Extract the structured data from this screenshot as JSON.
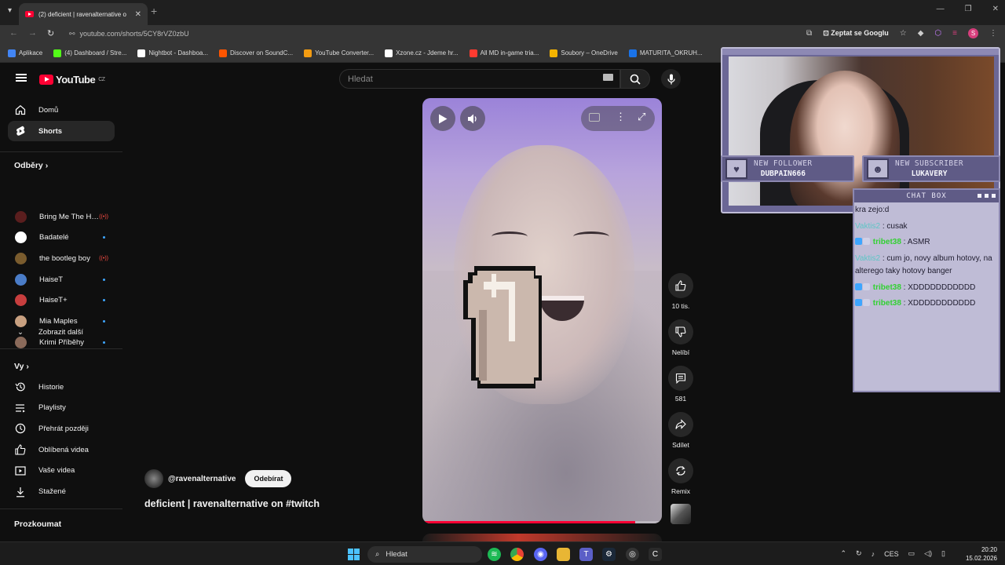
{
  "browser": {
    "tab_title": "(2) deficient | ravenalternative o",
    "url": "youtube.com/shorts/5CY8rVZ0zbU",
    "ask_google": "Zeptat se Googlu",
    "profile_initial": "S",
    "bookmarks": [
      {
        "label": "Aplikace",
        "color": "#4285f4"
      },
      {
        "label": "(4) Dashboard / Stre...",
        "color": "#53fc18"
      },
      {
        "label": "Nightbot - Dashboa...",
        "color": "#ffffff"
      },
      {
        "label": "Discover on SoundC...",
        "color": "#ff5500"
      },
      {
        "label": "YouTube Converter...",
        "color": "#f39c12"
      },
      {
        "label": "Xzone.cz - Jdeme hr...",
        "color": "#ffffff"
      },
      {
        "label": "All MD in-game tria...",
        "color": "#ff3b30"
      },
      {
        "label": "Soubory – OneDrive",
        "color": "#f4b400"
      },
      {
        "label": "MATURITA_OKRUH...",
        "color": "#1a73e8"
      }
    ]
  },
  "youtube": {
    "logo_text": "YouTube",
    "region": "CZ",
    "search_placeholder": "Hledat",
    "sidebar": {
      "main": [
        {
          "label": "Domů",
          "icon": "home-icon"
        },
        {
          "label": "Shorts",
          "icon": "shorts-icon",
          "active": true
        }
      ],
      "subs_title": "Odběry",
      "subs": [
        {
          "label": "Bring Me The Ho...",
          "avatar": "#5a1e1e",
          "live": true
        },
        {
          "label": "Badatelé",
          "avatar": "#ffffff",
          "live": false
        },
        {
          "label": "the bootleg boy",
          "avatar": "#7a5c2e",
          "live": true
        },
        {
          "label": "HaiseT",
          "avatar": "#4a7cc7",
          "live": false
        },
        {
          "label": "HaiseT+",
          "avatar": "#c73e3e",
          "live": false
        },
        {
          "label": "Mia Maples",
          "avatar": "#c8a080",
          "live": false
        },
        {
          "label": "Krimi Příběhy",
          "avatar": "#8a6a5a",
          "live": false
        }
      ],
      "show_more": "Zobrazit další",
      "you_title": "Vy",
      "you": [
        {
          "label": "Historie",
          "icon": "history-icon"
        },
        {
          "label": "Playlisty",
          "icon": "playlist-icon"
        },
        {
          "label": "Přehrát později",
          "icon": "clock-icon"
        },
        {
          "label": "Oblíbená videa",
          "icon": "like-icon"
        },
        {
          "label": "Vaše videa",
          "icon": "video-icon"
        },
        {
          "label": "Stažené",
          "icon": "download-icon"
        }
      ],
      "explore_title": "Prozkoumat"
    },
    "short": {
      "channel": "@ravenalternative",
      "subscribe_label": "Odebírat",
      "title": "deficient | ravenalternative on #twitch",
      "likes": "10 tis.",
      "dislike_label": "Nelíbí",
      "comments": "581",
      "share_label": "Sdílet",
      "remix_label": "Remix",
      "progress": 0.89
    }
  },
  "stream_overlay": {
    "new_follower_label": "NEW FOLLOWER",
    "new_follower_name": "DUBPAIN666",
    "new_subscriber_label": "NEW SUBSCRIBER",
    "new_subscriber_name": "LUKAVERY",
    "chat_title": "CHAT BOX",
    "messages": [
      {
        "user": "",
        "text": "kra zejo:d"
      },
      {
        "user": "Vaktis2",
        "text": " : cusak",
        "user_class": "teal"
      },
      {
        "user": "tribet38",
        "text": " : ASMR",
        "user_class": "green",
        "badges": true
      },
      {
        "user": "Vaktis2",
        "text": " : cum jo, novy album hotovy, na alterego taky hotovy banger",
        "user_class": "teal"
      },
      {
        "user": "tribet38",
        "text": " : XDDDDDDDDDDD",
        "user_class": "green",
        "badges": true
      },
      {
        "user": "tribet38",
        "text": " : XDDDDDDDDDDD",
        "user_class": "green",
        "badges": true
      }
    ]
  },
  "taskbar": {
    "search_label": "Hledat",
    "language": "CES",
    "time": "20:20",
    "date": "15.02.2026"
  }
}
